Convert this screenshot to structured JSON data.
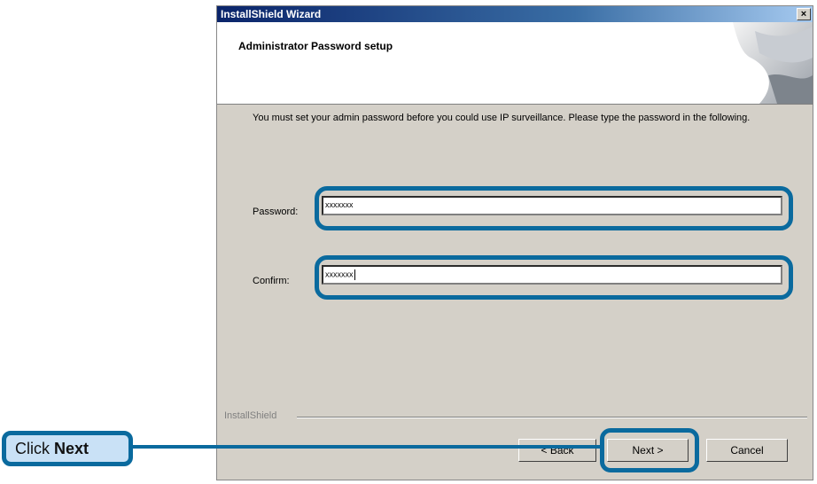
{
  "window": {
    "title": "InstallShield Wizard",
    "close_glyph": "×"
  },
  "header": {
    "title": "Administrator Password setup"
  },
  "body": {
    "instructions": "You must set your admin password before you could use IP surveillance. Please type the password in the following."
  },
  "fields": {
    "password_label": "Password:",
    "password_value": "xxxxxxx",
    "confirm_label": "Confirm:",
    "confirm_value": "xxxxxxx"
  },
  "footer": {
    "brand": "InstallShield",
    "back_label": "< Back",
    "next_label": "Next >",
    "cancel_label": "Cancel"
  },
  "callout": {
    "prefix": "Click",
    "emphasis": "Next"
  },
  "colors": {
    "highlight": "#0a6a9e",
    "callout_fill": "#c9e1f6",
    "dialog_bg": "#d4d0c8",
    "titlebar": "#0a246a"
  }
}
